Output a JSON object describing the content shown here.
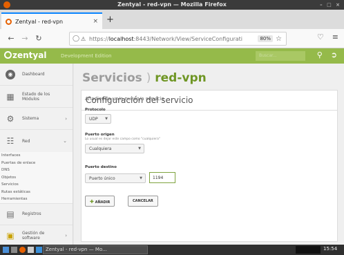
{
  "window": {
    "title": "Zentyal - red-vpn — Mozilla Firefox"
  },
  "browser": {
    "tab_title": "Zentyal - red-vpn",
    "url_prefix": "https://",
    "url_host": "localhost",
    "url_rest": ":8443/Network/View/ServiceConfigurati",
    "zoom": "80%"
  },
  "header": {
    "logo": "zentyal",
    "edition": "Development Edition",
    "search_placeholder": "Buscar..."
  },
  "sidebar": {
    "items": [
      {
        "label": "Dashboard",
        "icon": "dashboard-icon"
      },
      {
        "label": "Estado de los\nMódulos",
        "icon": "module-status-icon"
      },
      {
        "label": "Sistema",
        "icon": "gear-icon"
      },
      {
        "label": "Red",
        "icon": "network-icon"
      }
    ],
    "submenu": [
      "Interfaces",
      "Puertas de enlace",
      "DNS",
      "Objetos",
      "Servicios",
      "Rutas estáticas",
      "Herramientas"
    ],
    "bottom_items": [
      {
        "label": "Registros",
        "icon": "logs-icon"
      },
      {
        "label": "Gestión de\nsoftware",
        "icon": "software-icon"
      }
    ]
  },
  "main": {
    "title_parent": "Servicios",
    "title_separator": ")",
    "title_current": "red-vpn",
    "card_title": "Configuración del servicio",
    "form_subtitle": "Añadiendo un/a nuevo/a servicio",
    "protocol_label": "Protocolo",
    "protocol_value": "UDP",
    "source_port_label": "Puerto origen",
    "source_port_help": "Lo usual es dejar este campo como \"cualquiera\"",
    "source_port_value": "Cualquiera",
    "dest_port_label": "Puerto destino",
    "dest_port_type": "Puerto único",
    "dest_port_value": "1194",
    "add_button": "AÑADIR",
    "cancel_button": "CANCELAR"
  },
  "taskbar": {
    "task_label": "Zentyal - red-vpn — Mo...",
    "clock": "15:54"
  },
  "colors": {
    "zentyal_green": "#95ba4a",
    "title_green": "#6f9624"
  }
}
